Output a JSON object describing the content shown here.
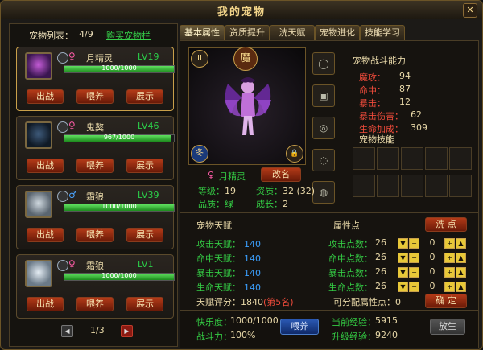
{
  "window": {
    "title": "我的宠物",
    "close": "✕"
  },
  "left": {
    "list_label": "宠物列表：",
    "count": "4/9",
    "buy_link": "购买宠物栏",
    "pets": [
      {
        "name": "月精灵",
        "level": "LV19",
        "gender": "♀",
        "hp": "1000/1000",
        "hp_pct": 100,
        "btn_fight": "出战",
        "btn_feed": "喂养",
        "btn_show": "展示"
      },
      {
        "name": "鬼獒",
        "level": "LV46",
        "gender": "♀",
        "hp": "967/1000",
        "hp_pct": 96.7,
        "btn_fight": "出战",
        "btn_feed": "喂养",
        "btn_show": "展示"
      },
      {
        "name": "霜狼",
        "level": "LV39",
        "gender": "♂",
        "hp": "1000/1000",
        "hp_pct": 100,
        "btn_fight": "出战",
        "btn_feed": "喂养",
        "btn_show": "展示"
      },
      {
        "name": "霜狼",
        "level": "LV1",
        "gender": "♀",
        "hp": "1000/1000",
        "hp_pct": 100,
        "btn_fight": "出战",
        "btn_feed": "喂养",
        "btn_show": "展示"
      }
    ],
    "pager": {
      "prev": "◀",
      "page": "1/3",
      "next": "▶"
    }
  },
  "tabs": [
    "基本属性",
    "资质提升",
    "洗天赋",
    "宠物进化",
    "技能学习"
  ],
  "pet": {
    "badge": "魔",
    "pause": "II",
    "season": "冬",
    "lock": "🔒",
    "gender": "♀",
    "name": "月精灵",
    "rename": "改名",
    "level_label": "等级：",
    "level": "19",
    "aptitude_label": "资质：",
    "aptitude": "32 (32)",
    "quality_label": "品质：",
    "quality": "绿",
    "growth_label": "成长：",
    "growth": "2"
  },
  "combat": {
    "title": "宠物战斗能力",
    "rows": [
      {
        "k": "魔攻：",
        "v": "94"
      },
      {
        "k": "命中：",
        "v": "87"
      },
      {
        "k": "暴击：",
        "v": "12"
      },
      {
        "k": "暴击伤害：",
        "v": "62"
      },
      {
        "k": "生命加成：",
        "v": "309"
      }
    ],
    "skills_title": "宠物技能"
  },
  "talent": {
    "title": "宠物天赋",
    "rows": [
      {
        "k": "攻击天赋：",
        "v": "140"
      },
      {
        "k": "命中天赋：",
        "v": "140"
      },
      {
        "k": "暴击天赋：",
        "v": "140"
      },
      {
        "k": "生命天赋：",
        "v": "140"
      }
    ],
    "score_label": "天赋评分：",
    "score": "1840",
    "rank": "(第5名)"
  },
  "points": {
    "title": "属性点",
    "wash_button": "洗 点",
    "rows": [
      {
        "k": "攻击点数：",
        "v": "26",
        "add": "0"
      },
      {
        "k": "命中点数：",
        "v": "26",
        "add": "0"
      },
      {
        "k": "暴击点数：",
        "v": "26",
        "add": "0"
      },
      {
        "k": "生命点数：",
        "v": "26",
        "add": "0"
      }
    ],
    "alloc_label": "可分配属性点：",
    "alloc": "0",
    "confirm_button": "确 定"
  },
  "bottom": {
    "happy_label": "快乐度：",
    "happy": "1000/1000",
    "power_label": "战斗力：",
    "power": "100%",
    "feed_button": "喂养",
    "exp_label": "当前经验：",
    "exp": "5915",
    "up_label": "升级经验：",
    "up": "9240",
    "release_button": "放生"
  }
}
